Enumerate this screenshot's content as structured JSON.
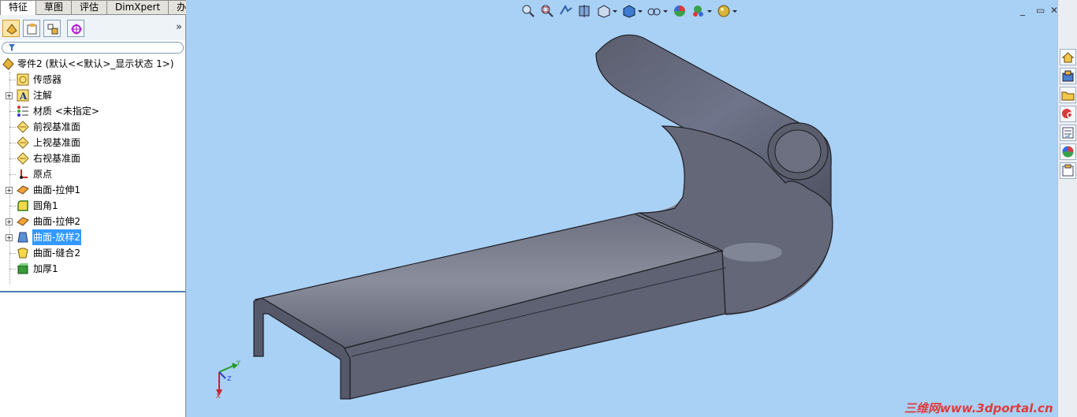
{
  "tabs": [
    "特征",
    "草图",
    "评估",
    "DimXpert",
    "办公室产品"
  ],
  "active_tab": "特征",
  "panel_tabs": [
    "feature-manager-icon",
    "property-manager-icon",
    "configuration-manager-icon",
    "dimxpert-manager-icon"
  ],
  "expand_label": "»",
  "tree": {
    "root": "零件2 (默认<<默认>_显示状态 1>)",
    "items": [
      {
        "label": "传感器",
        "icon": "sensor-icon"
      },
      {
        "label": "注解",
        "icon": "annotation-icon"
      },
      {
        "label": "材质 <未指定>",
        "icon": "material-icon"
      },
      {
        "label": "前视基准面",
        "icon": "plane-icon"
      },
      {
        "label": "上视基准面",
        "icon": "plane-icon"
      },
      {
        "label": "右视基准面",
        "icon": "plane-icon"
      },
      {
        "label": "原点",
        "icon": "origin-icon"
      },
      {
        "label": "曲面-拉伸1",
        "icon": "surface-extrude-icon"
      },
      {
        "label": "圆角1",
        "icon": "fillet-icon"
      },
      {
        "label": "曲面-拉伸2",
        "icon": "surface-extrude-icon"
      },
      {
        "label": "曲面-放样2",
        "icon": "surface-loft-icon"
      },
      {
        "label": "曲面-缝合2",
        "icon": "surface-knit-icon"
      },
      {
        "label": "加厚1",
        "icon": "thicken-icon"
      }
    ],
    "selected": "曲面-放样2"
  },
  "window_controls": [
    "_",
    "▭",
    "✕"
  ],
  "triad_labels": {
    "x": "X",
    "y": "Y",
    "z": "Z"
  },
  "watermark": "三维网www.3dportal.cn",
  "colors": {
    "viewport": "#a9d0f5",
    "part": "#5f6373",
    "selection": "#3399ff",
    "accent": "#e23a3a"
  }
}
